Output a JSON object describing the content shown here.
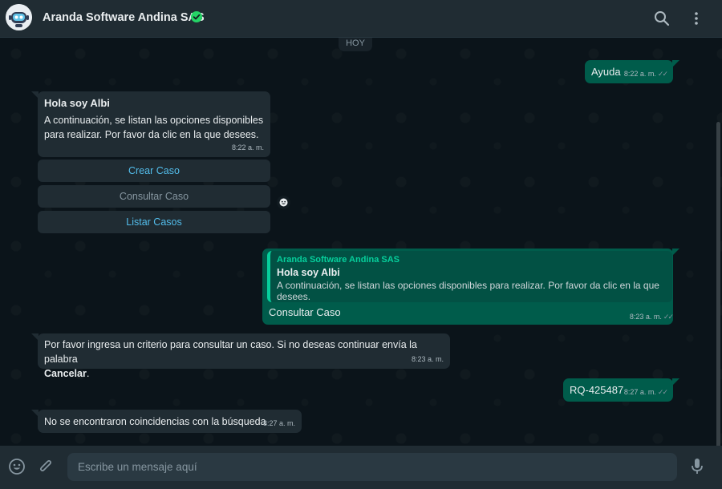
{
  "header": {
    "contact_name": "Aranda Software Andina SAS",
    "verified_icon": "verified-badge-icon",
    "search_icon": "search-icon",
    "menu_icon": "more-vertical-icon"
  },
  "chat": {
    "day_label": "HOY",
    "msg1": {
      "text": "Ayuda",
      "time": "8:22 a. m."
    },
    "msg2": {
      "title": "Hola soy Albi",
      "body": "A continuación, se listan las opciones disponibles para realizar. Por favor da clic en la que desees.",
      "time": "8:22 a. m.",
      "buttons": [
        "Crear Caso",
        "Consultar Caso",
        "Listar Casos"
      ]
    },
    "msg3": {
      "quote_author": "Aranda Software Andina SAS",
      "quote_title": "Hola soy Albi",
      "quote_text": "A continuación, se listan las opciones disponibles para realizar. Por favor da clic en la que desees.",
      "text": "Consultar Caso",
      "time": "8:23 a. m."
    },
    "msg4": {
      "text": "Por favor ingresa un criterio para consultar un caso. Si no deseas continuar envía la palabra",
      "bold_word": "Cancelar",
      "suffix": ".",
      "time": "8:23 a. m."
    },
    "msg5": {
      "text": "RQ-425487",
      "time": "8:27 a. m."
    },
    "msg6": {
      "text": "No se encontraron coincidencias con la búsqueda",
      "time": "8:27 a. m."
    }
  },
  "footer": {
    "placeholder": "Escribe un mensaje aquí"
  },
  "colors": {
    "background": "#0b141a",
    "header": "#202c33",
    "incoming": "#202c33",
    "outgoing": "#005c4b",
    "accent": "#06cf9c",
    "link": "#53bdeb"
  }
}
